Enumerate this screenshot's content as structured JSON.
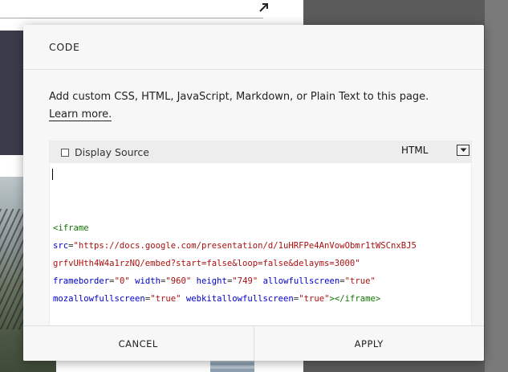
{
  "dialog": {
    "title": "CODE",
    "description": "Add custom CSS, HTML, JavaScript, Markdown, or Plain Text to this page.",
    "learn_more": "Learn more."
  },
  "editor": {
    "display_source_label": "Display Source",
    "language": "HTML",
    "code_lines": [
      [
        {
          "t": "tag",
          "v": "<iframe"
        }
      ],
      [
        {
          "t": "attr",
          "v": "src"
        },
        {
          "t": "punct",
          "v": "="
        },
        {
          "t": "str",
          "v": "\"https://docs.google.com/presentation/d/1uHRFPe4AnVowObmr1tWSCnxBJ5"
        }
      ],
      [
        {
          "t": "str",
          "v": "grfvUHth4W4a1rzNQ/embed?start=false&loop=false&delayms=3000\""
        }
      ],
      [
        {
          "t": "attr",
          "v": "frameborder"
        },
        {
          "t": "punct",
          "v": "="
        },
        {
          "t": "str",
          "v": "\"0\""
        },
        {
          "t": "punct",
          "v": " "
        },
        {
          "t": "attr",
          "v": "width"
        },
        {
          "t": "punct",
          "v": "="
        },
        {
          "t": "str",
          "v": "\"960\""
        },
        {
          "t": "punct",
          "v": " "
        },
        {
          "t": "attr",
          "v": "height"
        },
        {
          "t": "punct",
          "v": "="
        },
        {
          "t": "str",
          "v": "\"749\""
        },
        {
          "t": "punct",
          "v": " "
        },
        {
          "t": "attr",
          "v": "allowfullscreen"
        },
        {
          "t": "punct",
          "v": "="
        },
        {
          "t": "str",
          "v": "\"true\""
        }
      ],
      [
        {
          "t": "attr",
          "v": "mozallowfullscreen"
        },
        {
          "t": "punct",
          "v": "="
        },
        {
          "t": "str",
          "v": "\"true\""
        },
        {
          "t": "punct",
          "v": " "
        },
        {
          "t": "attr",
          "v": "webkitallowfullscreen"
        },
        {
          "t": "punct",
          "v": "="
        },
        {
          "t": "str",
          "v": "\"true\""
        },
        {
          "t": "tag",
          "v": "></iframe>"
        }
      ]
    ]
  },
  "footer": {
    "cancel_label": "CANCEL",
    "apply_label": "APPLY"
  },
  "background": {
    "expand_icon": "arrow-up-right-icon"
  }
}
